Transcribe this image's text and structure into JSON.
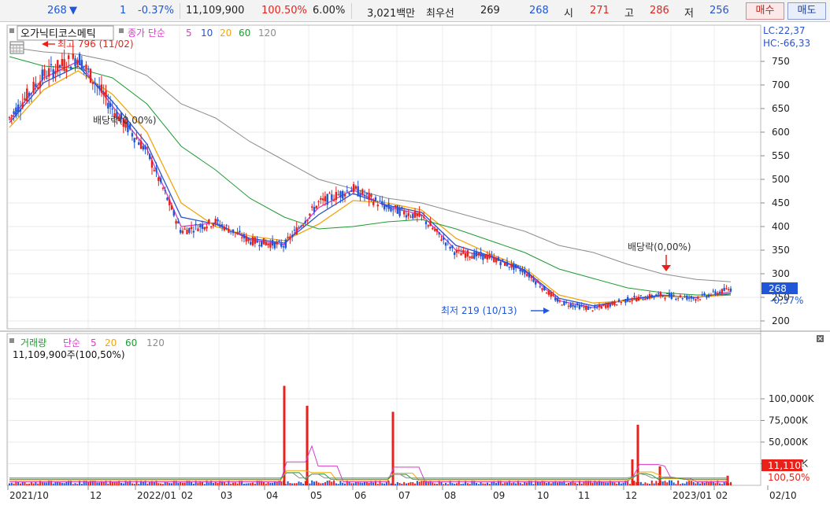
{
  "quote_bar": {
    "price": "268",
    "change_arrow": "▼",
    "change": "1",
    "change_pct": "-0.37%",
    "volume": "11,109,900",
    "volume_ratio": "100.50%",
    "turnover": "6.00%",
    "amount": "3,021백만",
    "best_ask_label": "최우선",
    "best_ask": "269",
    "best_bid": "268",
    "open_label": "시",
    "open": "271",
    "high_label": "고",
    "high": "286",
    "low_label": "저",
    "low": "256",
    "buy_label": "매수",
    "sell_label": "매도"
  },
  "price_panel": {
    "stock_name": "오가닉티코스메틱",
    "ma_label": "종가 단순",
    "ma_periods": [
      "5",
      "10",
      "20",
      "60",
      "120"
    ],
    "lc": "LC:22,37",
    "hc": "HC:-66,33",
    "high_annotation": "최고 796 (11/02)",
    "low_annotation": "최저 219 (10/13)",
    "dividend_1": "배당락(0,00%)",
    "dividend_2": "배당락(0,00%)",
    "current_price_tag": "268",
    "current_pct_tag": "-0,37%"
  },
  "volume_panel": {
    "title": "거래량",
    "ma_label": "단순",
    "ma_periods": [
      "5",
      "20",
      "60",
      "120"
    ],
    "current_volume": "11,109,900주(100,50%)",
    "current_tag": "11,110K",
    "current_pct_tag": "100,50%"
  },
  "colors": {
    "up": "#e8221b",
    "down": "#1f57d8",
    "ma5": "#d63dc8",
    "ma10": "#2c52c8",
    "ma20": "#f2a50c",
    "ma60": "#1f9a32",
    "ma120": "#8c8c8c",
    "ask_color": "#1f57d8"
  },
  "chart_data": [
    {
      "type": "candlestick",
      "title": "오가닉티코스메틱",
      "ylim": [
        175,
        800
      ],
      "y_ticks": [
        200,
        250,
        300,
        350,
        400,
        450,
        500,
        550,
        600,
        650,
        700,
        750
      ],
      "x_tick_labels": [
        "2021/10",
        "12",
        "2022/01",
        "02",
        "03",
        "04",
        "05",
        "06",
        "07",
        "08",
        "09",
        "10",
        "11",
        "12",
        "2023/01",
        "02",
        "02/10"
      ],
      "x": [
        "2021-10",
        "2021-11",
        "2021-11-02",
        "2021-12",
        "2022-01",
        "2022-01-25",
        "2022-02",
        "2022-03",
        "2022-04",
        "2022-04-20",
        "2022-05",
        "2022-06",
        "2022-06-28",
        "2022-07",
        "2022-08",
        "2022-09",
        "2022-10",
        "2022-10-13",
        "2022-11",
        "2022-12",
        "2023-01",
        "2023-02"
      ],
      "close": [
        630,
        720,
        760,
        650,
        560,
        390,
        410,
        370,
        360,
        450,
        480,
        440,
        420,
        345,
        335,
        305,
        240,
        225,
        245,
        255,
        248,
        268
      ],
      "series": [
        {
          "name": "5",
          "values": [
            625,
            715,
            750,
            655,
            565,
            400,
            408,
            372,
            362,
            440,
            478,
            442,
            425,
            350,
            336,
            306,
            243,
            228,
            246,
            255,
            249,
            262
          ]
        },
        {
          "name": "10",
          "values": [
            620,
            705,
            740,
            665,
            575,
            420,
            405,
            375,
            365,
            425,
            470,
            445,
            430,
            360,
            338,
            308,
            248,
            232,
            245,
            254,
            250,
            258
          ]
        },
        {
          "name": "20",
          "values": [
            610,
            690,
            730,
            680,
            600,
            450,
            400,
            380,
            370,
            405,
            455,
            450,
            435,
            375,
            342,
            312,
            255,
            238,
            243,
            252,
            251,
            255
          ]
        },
        {
          "name": "60",
          "values": [
            760,
            740,
            735,
            715,
            660,
            570,
            520,
            460,
            420,
            395,
            400,
            410,
            415,
            395,
            370,
            345,
            310,
            290,
            270,
            260,
            255,
            255
          ]
        },
        {
          "name": "120",
          "values": [
            780,
            770,
            765,
            750,
            720,
            660,
            630,
            580,
            540,
            500,
            480,
            460,
            450,
            430,
            410,
            390,
            360,
            345,
            320,
            300,
            288,
            283
          ]
        }
      ]
    },
    {
      "type": "bar",
      "title": "거래량",
      "ylim": [
        0,
        130000
      ],
      "y_ticks": [
        25000,
        50000,
        75000,
        100000
      ],
      "y_tick_labels": [
        "25,000K",
        "50,000K",
        "75,000K",
        "100,000K"
      ],
      "spikes": [
        {
          "label": "2022/04",
          "value": 115000
        },
        {
          "label": "2022/04b",
          "value": 92000
        },
        {
          "label": "2022/06",
          "value": 85000
        },
        {
          "label": "2022/12",
          "value": 70000
        },
        {
          "label": "2022/12b",
          "value": 30000
        },
        {
          "label": "2022/12c",
          "value": 22000
        }
      ],
      "current_value": 11110
    }
  ]
}
